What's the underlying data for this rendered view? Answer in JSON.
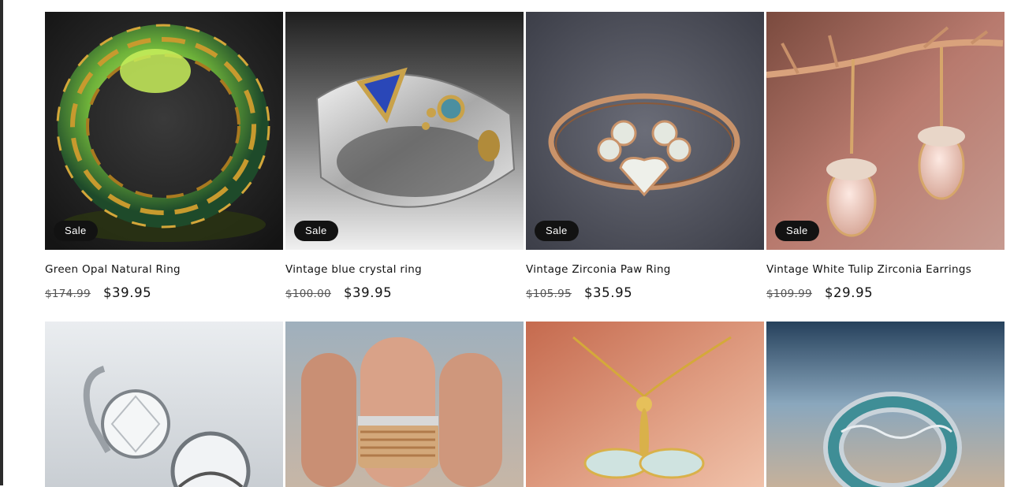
{
  "products": [
    {
      "title": "Green Opal Natural Ring",
      "compare_price": "$174.99",
      "price": "$39.95",
      "badge": "Sale",
      "image": "green-opal-ring-image"
    },
    {
      "title": "Vintage blue crystal ring",
      "compare_price": "$100.00",
      "price": "$39.95",
      "badge": "Sale",
      "image": "blue-crystal-ring-image"
    },
    {
      "title": "Vintage Zirconia Paw Ring",
      "compare_price": "$105.95",
      "price": "$35.95",
      "badge": "Sale",
      "image": "paw-ring-image"
    },
    {
      "title": "Vintage White Tulip Zirconia Earrings",
      "compare_price": "$109.99",
      "price": "$29.95",
      "badge": "Sale",
      "image": "tulip-earrings-image"
    }
  ],
  "products_row2": [
    {
      "image": "diamond-earrings-image"
    },
    {
      "image": "wrap-ring-image"
    },
    {
      "image": "dragonfly-necklace-image"
    },
    {
      "image": "wave-ring-image"
    }
  ],
  "colors": {
    "badge_bg": "#121212",
    "badge_text": "#ffffff",
    "text": "#121212",
    "muted": "#555555"
  }
}
